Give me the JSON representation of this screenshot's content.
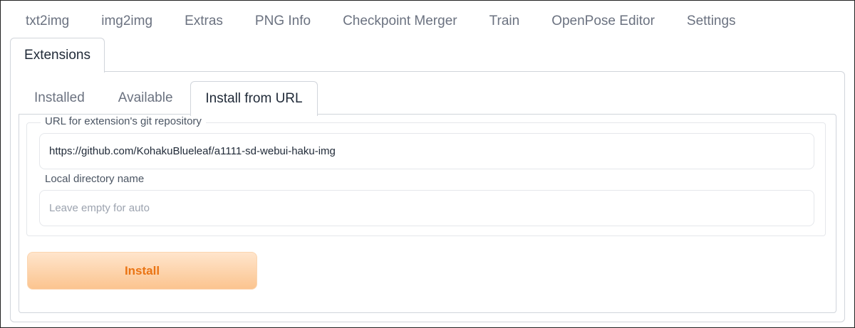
{
  "top_tabs": [
    "txt2img",
    "img2img",
    "Extras",
    "PNG Info",
    "Checkpoint Merger",
    "Train",
    "OpenPose Editor",
    "Settings"
  ],
  "active_top_tab": "Extensions",
  "sub_tabs": [
    "Installed",
    "Available"
  ],
  "active_sub_tab": "Install from URL",
  "url_field": {
    "label": "URL for extension's git repository",
    "value": "https://github.com/KohakuBlueleaf/a1111-sd-webui-haku-img"
  },
  "dir_field": {
    "label": "Local directory name",
    "value": "",
    "placeholder": "Leave empty for auto"
  },
  "install_button": {
    "label": "Install"
  },
  "colors": {
    "accent_text": "#ea7413",
    "button_gradient_top": "#ffe5cc",
    "button_gradient_bottom": "#fbc48f",
    "muted_text": "#6b7280"
  }
}
